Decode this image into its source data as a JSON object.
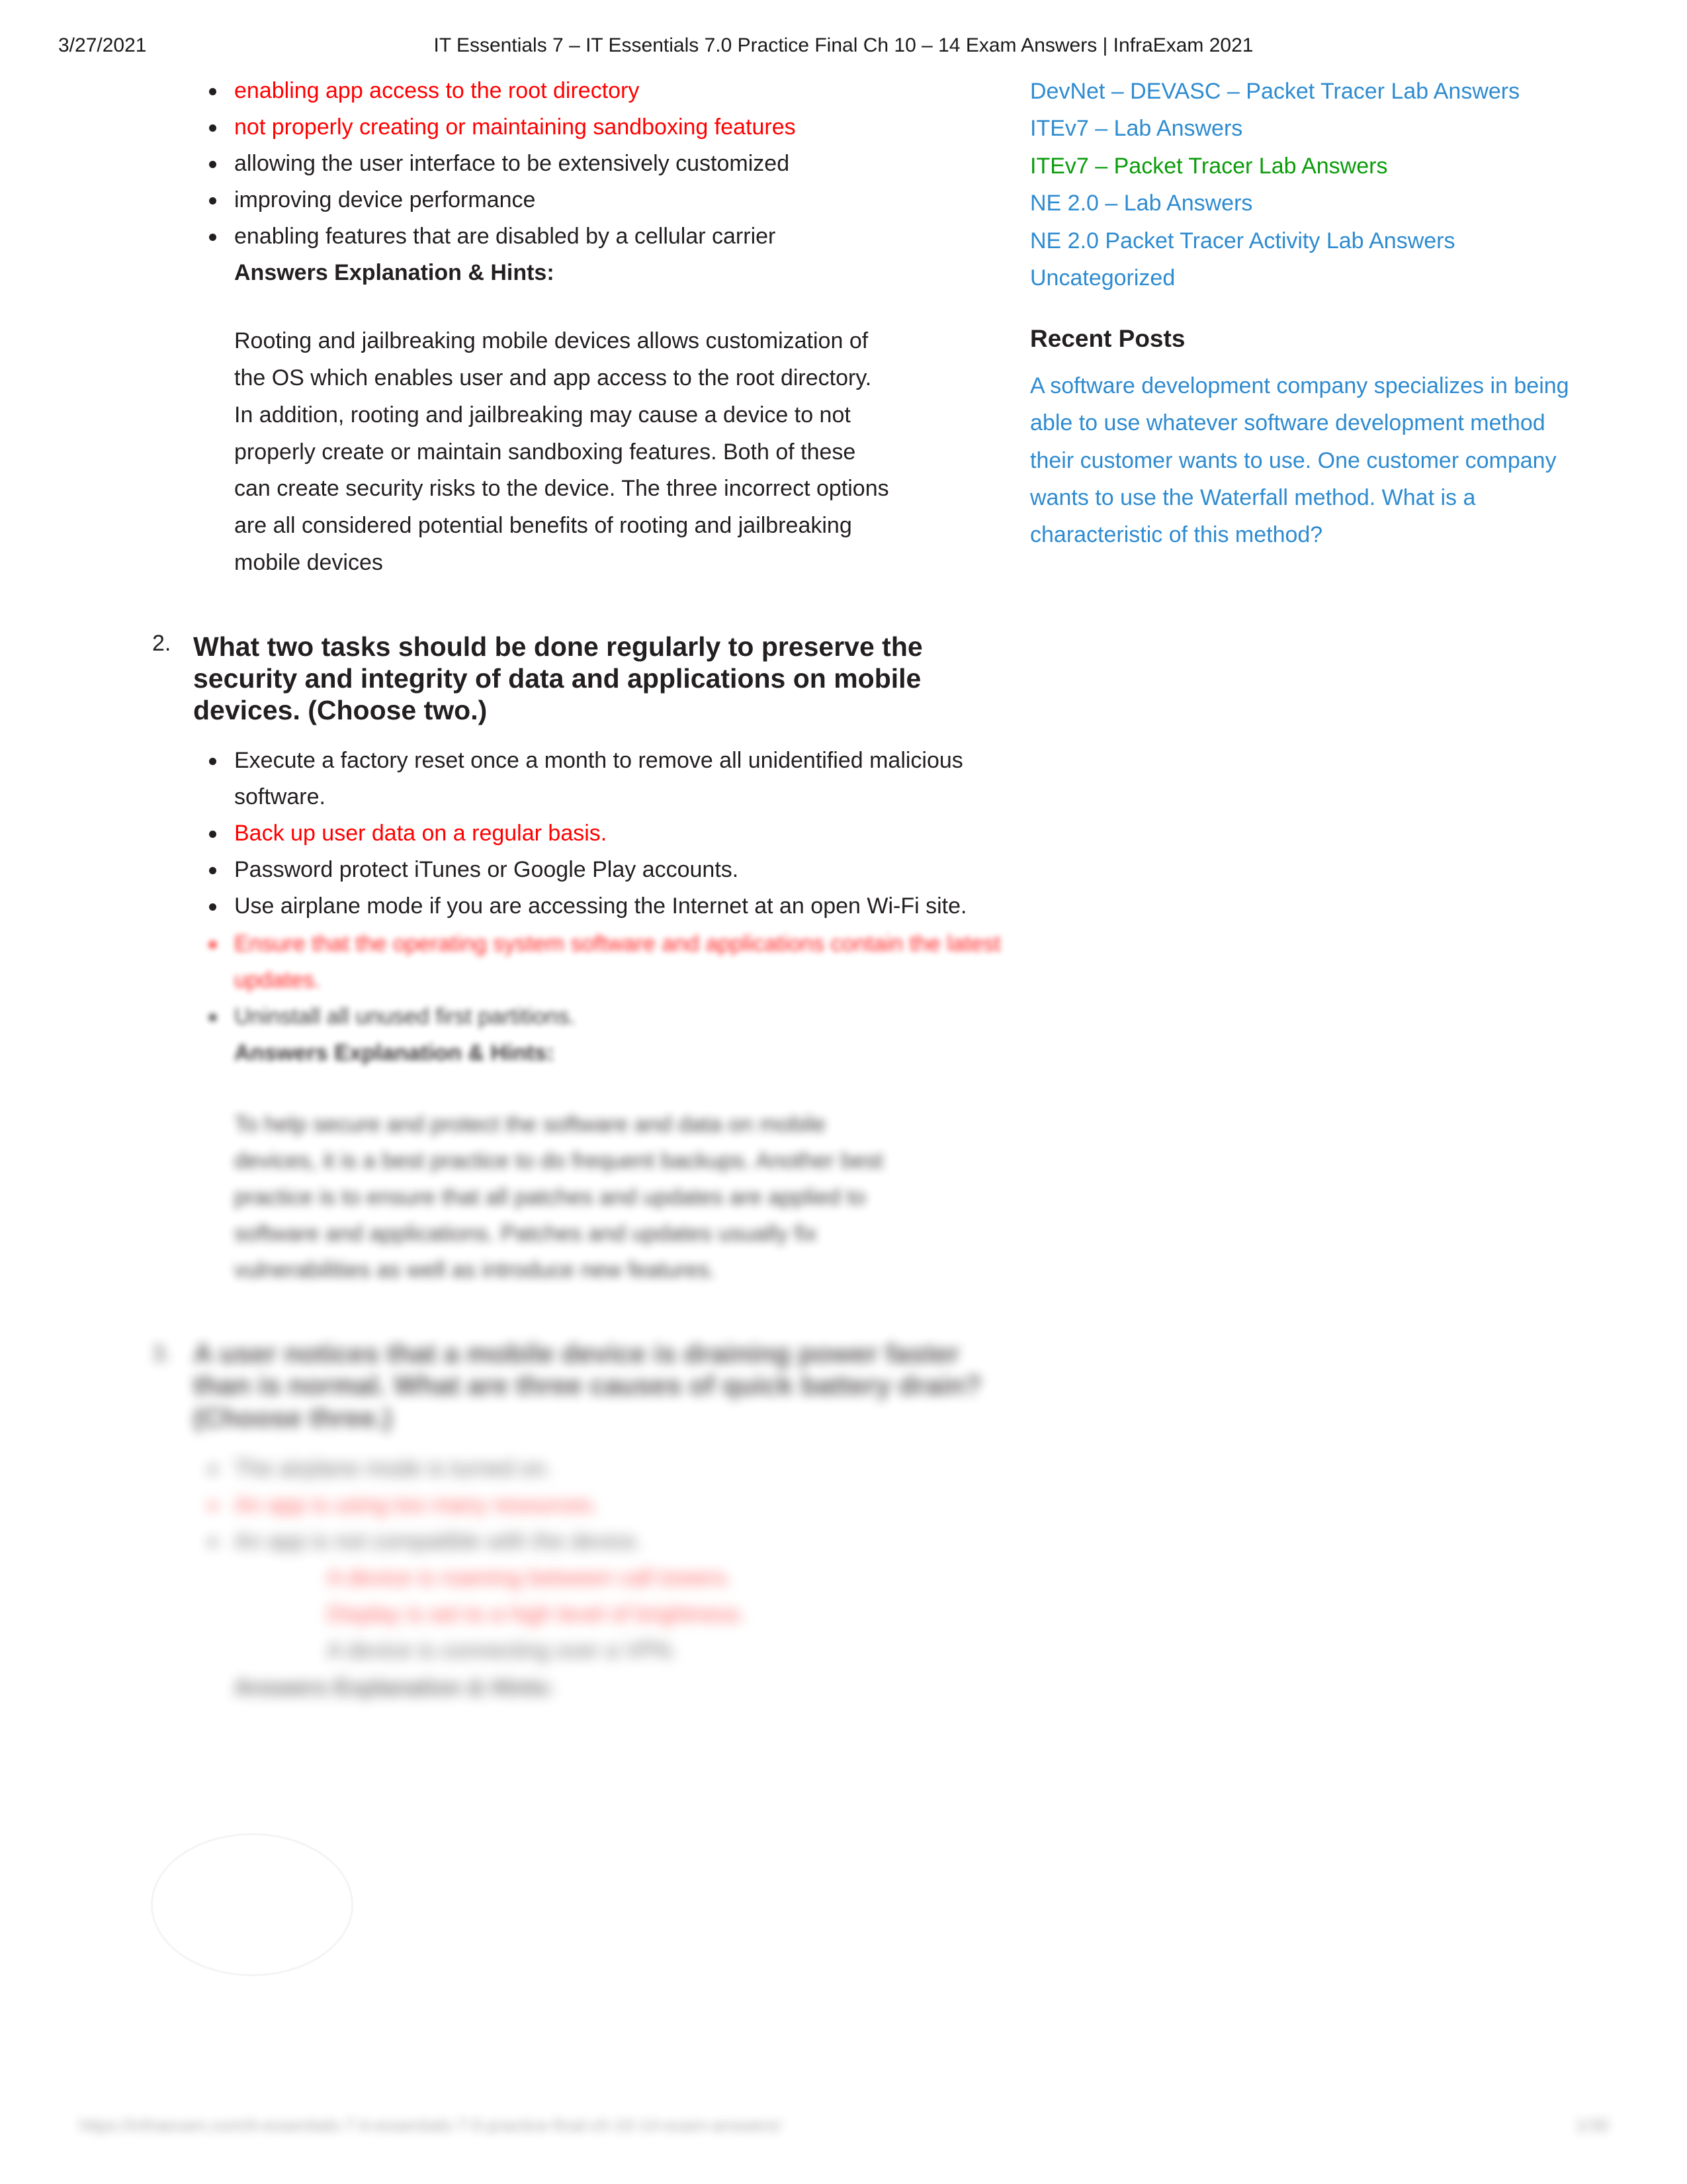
{
  "print_header": {
    "date": "3/27/2021",
    "title": "IT Essentials 7 – IT Essentials 7.0 Practice Final Ch 10 – 14 Exam Answers | InfraExam 2021"
  },
  "colors": {
    "link_blue": "#2e8bd0",
    "link_green": "#0a9c0a",
    "correct_answer_red": "#ff0000",
    "body_text": "#231f20"
  },
  "main": {
    "question_1_continued": {
      "answers": [
        {
          "text": "enabling app access to the root directory",
          "correct": true
        },
        {
          "text": "not properly creating or maintaining sandboxing features",
          "correct": true
        },
        {
          "text": "allowing the user interface to be extensively customized",
          "correct": false
        },
        {
          "text": "improving device performance",
          "correct": false
        },
        {
          "text": "enabling features that are disabled by a cellular carrier",
          "correct": false
        }
      ],
      "hints_label": "Answers Explanation & Hints:",
      "hints_body": "Rooting and jailbreaking mobile devices allows customization of the OS which enables user and app access to the root directory. In addition, rooting and jailbreaking may cause a device to not properly create or maintain sandboxing features. Both of these can create security risks to the device. The three incorrect options are all considered potential benefits of rooting and jailbreaking mobile devices"
    },
    "question_2": {
      "number": "2.",
      "title": "What two tasks should be done regularly to preserve the security and integrity of data and applications on mobile devices. (Choose two.)",
      "answers": [
        {
          "text": "Execute a factory reset once a month to remove all unidentified malicious software.",
          "correct": false
        },
        {
          "text": "Back up user data on a regular basis.",
          "correct": true
        },
        {
          "text": "Password protect iTunes or Google Play accounts.",
          "correct": false
        },
        {
          "text": "Use airplane mode if you are accessing the Internet at an open Wi-Fi site.",
          "correct": false
        }
      ],
      "blurred_answers": [
        {
          "text": "Ensure that the operating system software and applications contain the latest updates.",
          "correct": true
        },
        {
          "text": "Uninstall all unused first partitions.",
          "correct": false
        }
      ],
      "hints_label": "Answers Explanation & Hints:",
      "hints_body": "To help secure and protect the software and data on mobile devices, it is a best practice to do frequent backups. Another best practice is to ensure that all patches and updates are applied to software and applications. Patches and updates usually fix vulnerabilities as well as introduce new features."
    },
    "question_3": {
      "number": "3.",
      "title": "A user notices that a mobile device is draining power faster than is normal. What are three causes of quick battery drain? (Choose three.)",
      "answers": [
        {
          "text": "The airplane mode is turned on.",
          "correct": false
        },
        {
          "text": "An app is using too many resources.",
          "correct": true
        },
        {
          "text": "An app is not compatible with the device.",
          "correct": false
        },
        {
          "text": "A device is roaming between call towers.",
          "correct": true
        },
        {
          "text": "Display is set to a high level of brightness.",
          "correct": true
        },
        {
          "text": "A device is connecting over a VPN.",
          "correct": false
        }
      ],
      "hints_label": "Answers Explanation & Hints:"
    }
  },
  "sidebar": {
    "category_links": [
      {
        "label": "DevNet – DEVASC – Packet Tracer Lab Answers",
        "color": "blue"
      },
      {
        "label": "ITEv7 – Lab Answers",
        "color": "blue"
      },
      {
        "label": "ITEv7 – Packet Tracer Lab Answers",
        "color": "green"
      },
      {
        "label": "NE 2.0 – Lab Answers",
        "color": "blue"
      },
      {
        "label": "NE 2.0 Packet Tracer Activity Lab Answers",
        "color": "blue"
      },
      {
        "label": "Uncategorized",
        "color": "blue"
      }
    ],
    "recent_posts_heading": "Recent Posts",
    "recent_posts": [
      "A software development company specializes in being able to use whatever software development method their customer wants to use. One customer company wants to use the Waterfall method. What is a characteristic of this method?"
    ]
  },
  "print_footer": {
    "url": "https://infraexam.com/it-essentials-7-it-essentials-7-0-practice-final-ch-10-14-exam-answers/",
    "page": "1/30"
  }
}
